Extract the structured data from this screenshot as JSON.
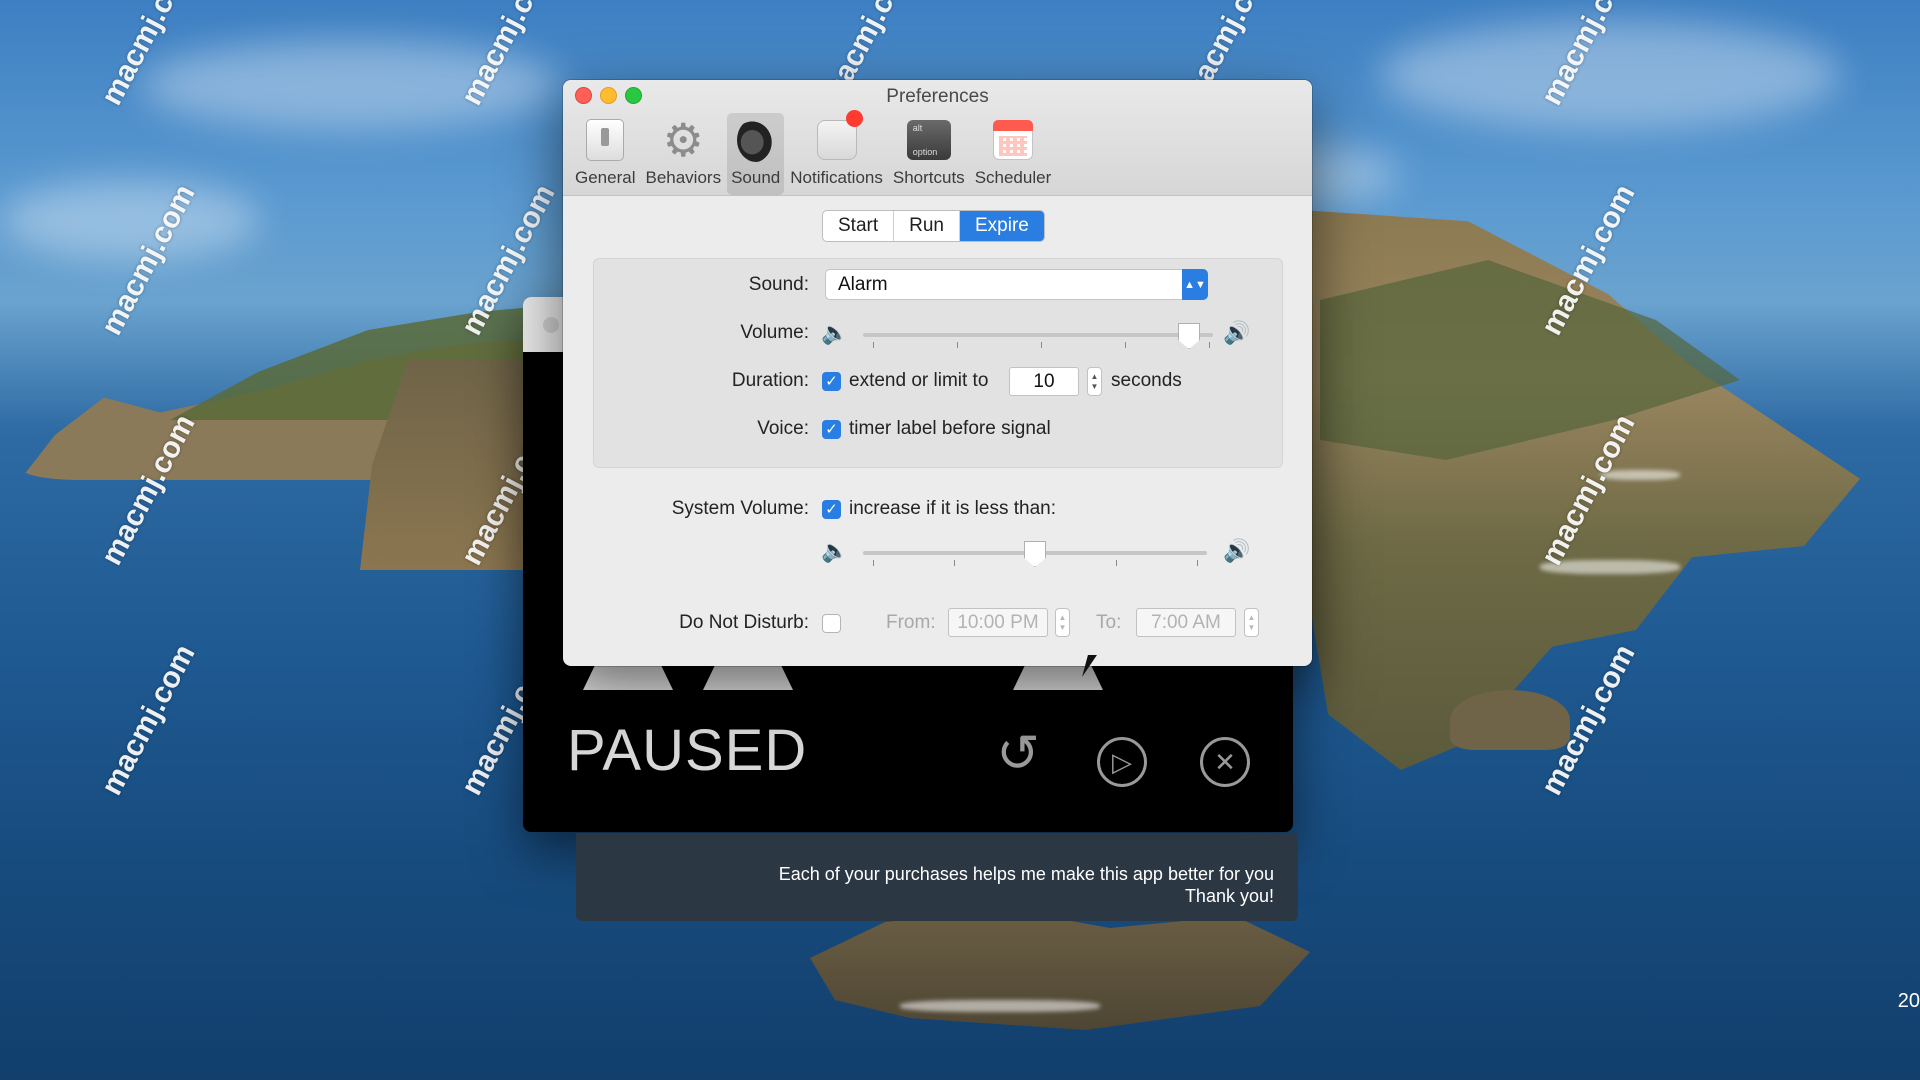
{
  "desktop": {
    "watermark_text": "macmj.com",
    "corner_text": "20"
  },
  "timer_window": {
    "status_label": "PAUSED",
    "reset_icon": "reset-icon",
    "play_icon": "play-icon",
    "close_icon": "close-icon"
  },
  "support_panel": {
    "line1": "Each of your purchases helps me make this app better for you",
    "line2": "Thank you!"
  },
  "preferences": {
    "title": "Preferences",
    "toolbar": [
      {
        "label": "General",
        "icon": "switch-icon"
      },
      {
        "label": "Behaviors",
        "icon": "gear-icon"
      },
      {
        "label": "Sound",
        "icon": "speaker-icon"
      },
      {
        "label": "Notifications",
        "icon": "notification-icon"
      },
      {
        "label": "Shortcuts",
        "icon": "keyboard-icon",
        "key_top": "alt",
        "key_bottom": "option"
      },
      {
        "label": "Scheduler",
        "icon": "calendar-icon"
      }
    ],
    "active_tab": "Sound",
    "segments": [
      "Start",
      "Run",
      "Expire"
    ],
    "active_segment": "Expire",
    "sound": {
      "label": "Sound:",
      "value": "Alarm"
    },
    "volume": {
      "label": "Volume:",
      "level": 0.96
    },
    "duration": {
      "label": "Duration:",
      "checkbox_label": "extend or limit to",
      "checked": true,
      "value": "10",
      "unit": "seconds"
    },
    "voice": {
      "label": "Voice:",
      "checkbox_label": "timer label before signal",
      "checked": true
    },
    "system_volume": {
      "label": "System Volume:",
      "checkbox_label": "increase if it is less than:",
      "checked": true,
      "level": 0.5
    },
    "dnd": {
      "label": "Do Not Disturb:",
      "checked": false,
      "from_label": "From:",
      "from_value": "10:00 PM",
      "to_label": "To:",
      "to_value": "7:00 AM"
    }
  },
  "colors": {
    "accent": "#2a7de1",
    "close": "#fe5f57",
    "minimize": "#febc2e",
    "maximize": "#28c840"
  }
}
